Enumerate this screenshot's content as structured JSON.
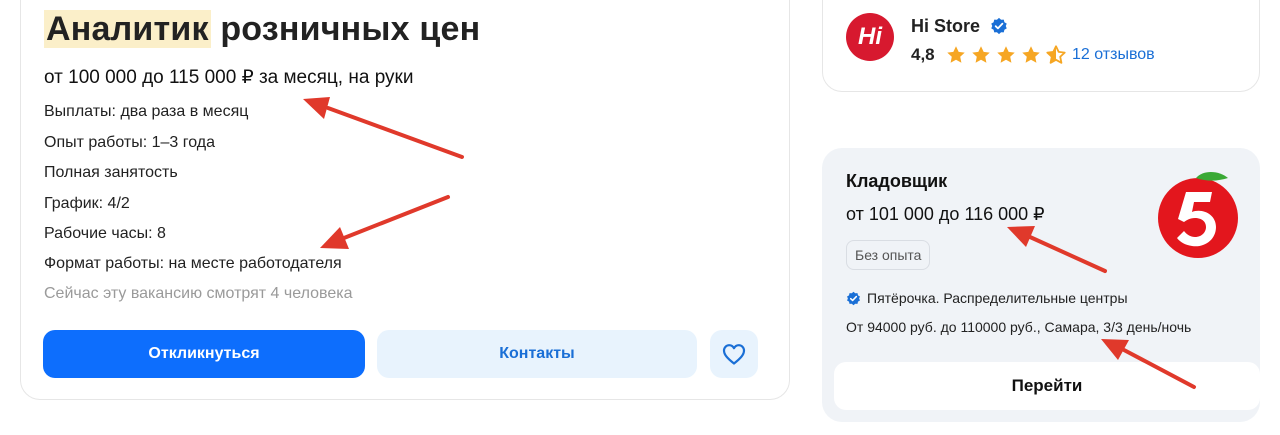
{
  "job": {
    "title_highlight": "Аналитик",
    "title_rest": " розничных цен",
    "salary": "от 100 000 до 115 000 ₽ за месяц, на руки",
    "details": [
      "Выплаты: два раза в месяц",
      "Опыт работы: 1–3 года",
      "Полная занятость",
      "График: 4/2",
      "Рабочие часы: 8",
      "Формат работы: на месте работодателя"
    ],
    "viewers": "Сейчас эту вакансию смотрят 4 человека",
    "respond_label": "Откликнуться",
    "contacts_label": "Контакты",
    "favorite_icon": "heart-icon"
  },
  "store": {
    "logo_text": "Hi",
    "name": "Hi Store",
    "rating": "4,8",
    "stars_value": 4.8,
    "reviews": "12 отзывов"
  },
  "vacancy": {
    "title": "Кладовщик",
    "salary": "от 101 000  до 116 000 ₽",
    "badge": "Без опыта",
    "company": "Пятёрочка. Распределительные центры",
    "details": "От 94000 руб. до 110000 руб., Самара, 3/3 день/ночь",
    "go_label": "Перейти"
  },
  "colors": {
    "primary": "#0d6efd",
    "highlight": "#fbefc9",
    "star": "#f6a623",
    "arrow": "#e0392b",
    "store_logo": "#d7192f"
  }
}
